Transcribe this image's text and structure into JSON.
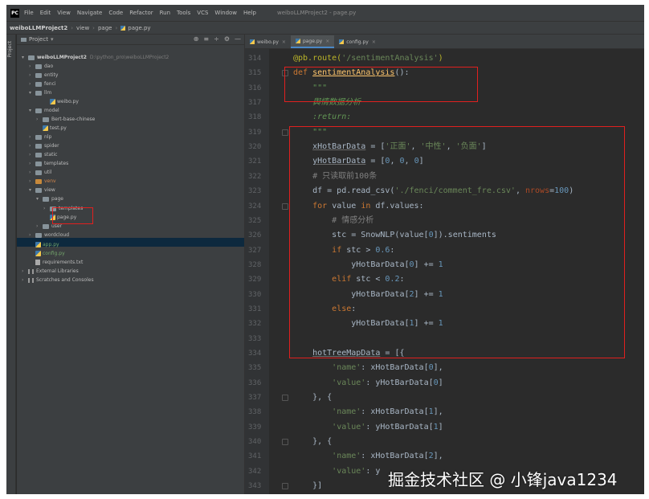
{
  "menubar": {
    "logo": "PC",
    "items": [
      "File",
      "Edit",
      "View",
      "Navigate",
      "Code",
      "Refactor",
      "Run",
      "Tools",
      "VCS",
      "Window",
      "Help"
    ],
    "project_title": "weiboLLMProject2 - page.py"
  },
  "navbar": {
    "crumbs": [
      "weiboLLMProject2",
      "view",
      "page",
      "page.py"
    ]
  },
  "left_strip": {
    "label": "Project"
  },
  "project_panel": {
    "title": "Project",
    "tools": [
      "⊕",
      "≡",
      "÷",
      "⚙",
      "—"
    ],
    "tree": [
      {
        "label": "weiboLLMProject2",
        "path": "D:\\python_pro\\weiboLLMProject2",
        "type": "folder",
        "indent": 0,
        "arrow": "▾",
        "style": "bold"
      },
      {
        "label": "dao",
        "type": "folder",
        "indent": 1,
        "arrow": "›"
      },
      {
        "label": "entity",
        "type": "folder",
        "indent": 1,
        "arrow": "›"
      },
      {
        "label": "fenci",
        "type": "folder",
        "indent": 1,
        "arrow": "›"
      },
      {
        "label": "llm",
        "type": "folder",
        "indent": 1,
        "arrow": "▾"
      },
      {
        "label": "weibo.py",
        "type": "py",
        "indent": 3,
        "arrow": ""
      },
      {
        "label": "model",
        "type": "folder",
        "indent": 1,
        "arrow": "▾"
      },
      {
        "label": "Bert-base-chinese",
        "type": "folder",
        "indent": 2,
        "arrow": "›"
      },
      {
        "label": "test.py",
        "type": "py",
        "indent": 2,
        "arrow": ""
      },
      {
        "label": "nlp",
        "type": "folder",
        "indent": 1,
        "arrow": "›"
      },
      {
        "label": "spider",
        "type": "folder",
        "indent": 1,
        "arrow": "›"
      },
      {
        "label": "static",
        "type": "folder",
        "indent": 1,
        "arrow": "›"
      },
      {
        "label": "templates",
        "type": "folder",
        "indent": 1,
        "arrow": "›"
      },
      {
        "label": "util",
        "type": "folder",
        "indent": 1,
        "arrow": "›"
      },
      {
        "label": "venv",
        "type": "folder-orange",
        "indent": 1,
        "arrow": "›",
        "style": "orange"
      },
      {
        "label": "view",
        "type": "folder",
        "indent": 1,
        "arrow": "▾"
      },
      {
        "label": "page",
        "type": "folder",
        "indent": 2,
        "arrow": "▾"
      },
      {
        "label": "templates",
        "type": "folder",
        "indent": 3,
        "arrow": "›"
      },
      {
        "label": "page.py",
        "type": "py",
        "indent": 3,
        "arrow": ""
      },
      {
        "label": "user",
        "type": "folder",
        "indent": 2,
        "arrow": "›"
      },
      {
        "label": "wordcloud",
        "type": "folder",
        "indent": 1,
        "arrow": "›"
      },
      {
        "label": "app.py",
        "type": "py",
        "indent": 1,
        "arrow": "",
        "style": "green"
      },
      {
        "label": "config.py",
        "type": "py",
        "indent": 1,
        "arrow": "",
        "style": "green"
      },
      {
        "label": "requirements.txt",
        "type": "txt",
        "indent": 1,
        "arrow": ""
      },
      {
        "label": "External Libraries",
        "type": "lib",
        "indent": 0,
        "arrow": "›"
      },
      {
        "label": "Scratches and Consoles",
        "type": "lib",
        "indent": 0,
        "arrow": "›"
      }
    ]
  },
  "tabs": [
    {
      "label": "weibo.py",
      "active": false
    },
    {
      "label": "page.py",
      "active": true
    },
    {
      "label": "config.py",
      "active": false
    }
  ],
  "editor": {
    "lines": [
      {
        "n": "314",
        "html": "<span class=\"dec\">@pb.route(</span><span class=\"str\">'/sentimentAnalysis'</span><span class=\"dec\">)</span>"
      },
      {
        "n": "315",
        "html": "<span class=\"kw\">def </span><span class=\"fn\">sentimentAnalysis</span>():"
      },
      {
        "n": "316",
        "html": "    <span class=\"doc\">\"\"\"</span>"
      },
      {
        "n": "317",
        "html": "    <span class=\"doc\">舆情数据分析</span>"
      },
      {
        "n": "318",
        "html": "    <span class=\"doc\">:return:</span>"
      },
      {
        "n": "319",
        "html": "    <span class=\"doc\">\"\"\"</span>"
      },
      {
        "n": "320",
        "html": "    <span class=\"var\">xHotBarData</span> = [<span class=\"str\">'正面'</span>, <span class=\"str\">'中性'</span>, <span class=\"str\">'负面'</span>]"
      },
      {
        "n": "321",
        "html": "    <span class=\"var\">yHotBarData</span> = [<span class=\"num\">0</span>, <span class=\"num\">0</span>, <span class=\"num\">0</span>]"
      },
      {
        "n": "322",
        "html": "    <span class=\"cm\"># 只读取前100条</span>"
      },
      {
        "n": "323",
        "html": "    df = pd.read_csv(<span class=\"str\">'./fenci/comment_fre.csv'</span>, <span class=\"param\">nrows</span>=<span class=\"num\">100</span>)"
      },
      {
        "n": "324",
        "html": "    <span class=\"kw\">for </span>value <span class=\"kw\">in </span>df.values:"
      },
      {
        "n": "325",
        "html": "        <span class=\"cm\"># 情感分析</span>"
      },
      {
        "n": "326",
        "html": "        stc = SnowNLP(value[<span class=\"num\">0</span>]).sentiments"
      },
      {
        "n": "327",
        "html": "        <span class=\"kw\">if </span>stc > <span class=\"num\">0.6</span>:"
      },
      {
        "n": "328",
        "html": "            yHotBarData[<span class=\"num\">0</span>] += <span class=\"num\">1</span>"
      },
      {
        "n": "329",
        "html": "        <span class=\"kw\">elif </span>stc < <span class=\"num\">0.2</span>:"
      },
      {
        "n": "330",
        "html": "            yHotBarData[<span class=\"num\">2</span>] += <span class=\"num\">1</span>"
      },
      {
        "n": "331",
        "html": "        <span class=\"kw\">else</span>:"
      },
      {
        "n": "332",
        "html": "            yHotBarData[<span class=\"num\">1</span>] += <span class=\"num\">1</span>"
      },
      {
        "n": "333",
        "html": ""
      },
      {
        "n": "334",
        "html": "    <span class=\"var\">hotTreeMapData</span> = [{"
      },
      {
        "n": "335",
        "html": "        <span class=\"str\">'name'</span>: xHotBarData[<span class=\"num\">0</span>],"
      },
      {
        "n": "336",
        "html": "        <span class=\"str\">'value'</span>: yHotBarData[<span class=\"num\">0</span>]"
      },
      {
        "n": "337",
        "html": "    }, {"
      },
      {
        "n": "338",
        "html": "        <span class=\"str\">'name'</span>: xHotBarData[<span class=\"num\">1</span>],"
      },
      {
        "n": "339",
        "html": "        <span class=\"str\">'value'</span>: yHotBarData[<span class=\"num\">1</span>]"
      },
      {
        "n": "340",
        "html": "    }, {"
      },
      {
        "n": "341",
        "html": "        <span class=\"str\">'name'</span>: xHotBarData[<span class=\"num\">2</span>],"
      },
      {
        "n": "342",
        "html": "        <span class=\"str\">'value'</span>: y"
      },
      {
        "n": "343",
        "html": "    }]"
      }
    ]
  },
  "watermark": "掘金技术社区 @ 小锋java1234",
  "colors": {
    "annotation_red": "#e0201f",
    "keyword": "#cc7832",
    "string": "#6a8759",
    "number": "#6897bb",
    "function": "#ffc66d",
    "selection": "#0d293e"
  }
}
